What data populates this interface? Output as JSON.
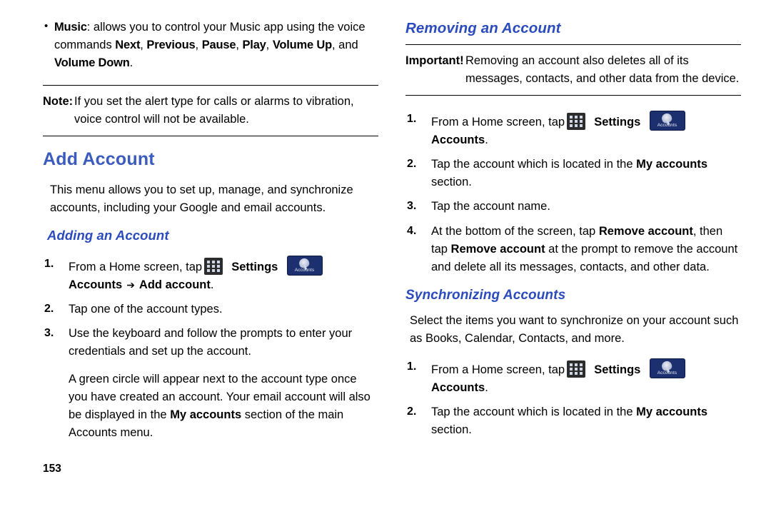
{
  "document": {
    "page_number": "153",
    "left_column": {
      "bullet": {
        "term": "Music",
        "text_1": ": allows you to control your Music app using the voice commands ",
        "cmd_1": "Next",
        "sep_1": ", ",
        "cmd_2": "Previous",
        "sep_2": ", ",
        "cmd_3": "Pause",
        "sep_3": ", ",
        "cmd_4": "Play",
        "sep_4": ", ",
        "cmd_5": "Volume Up",
        "sep_5": ", and ",
        "cmd_6": "Volume Down",
        "end": "."
      },
      "note": {
        "label": "Note:",
        "text": "If you set the alert type for calls or alarms to vibration, voice control will not be available."
      },
      "heading": "Add Account",
      "intro": "This menu allows you to set up, manage, and synchronize accounts, including your Google and email accounts.",
      "subheading": "Adding an Account",
      "steps": [
        {
          "num": "1.",
          "pre": "From a Home screen, tap",
          "icon_apps": "apps-icon",
          "bold_1": "Settings",
          "icon_accounts": "accounts-icon",
          "bold_2": "Accounts",
          "arrow": "➔",
          "bold_3": "Add account",
          "post": "."
        },
        {
          "num": "2.",
          "text": "Tap one of the account types."
        },
        {
          "num": "3.",
          "text": "Use the keyboard and follow the prompts to enter your credentials and set up the account."
        }
      ],
      "paragraph_pre": "A green circle will appear next to the account type once you have created an account. Your email account will also be displayed in the ",
      "paragraph_bold": "My accounts",
      "paragraph_post": " section of the main Accounts menu."
    },
    "right_column": {
      "heading": "Removing an Account",
      "important": {
        "label": "Important!",
        "text": "Removing an account also deletes all of its messages, contacts, and other data from the device."
      },
      "remove_steps": [
        {
          "num": "1.",
          "pre": "From a Home screen, tap",
          "icon_apps": "apps-icon",
          "bold_1": "Settings",
          "icon_accounts": "accounts-icon",
          "bold_2": "Accounts",
          "post": "."
        },
        {
          "num": "2.",
          "pre": "Tap the account which is located in the ",
          "bold": "My accounts",
          "post": " section."
        },
        {
          "num": "3.",
          "text": "Tap the account name."
        },
        {
          "num": "4.",
          "pre": "At the bottom of the screen, tap ",
          "bold_1": "Remove account",
          "mid_1": ", then tap ",
          "bold_2": "Remove account",
          "post": " at the prompt to remove the account and delete all its messages, contacts, and other data."
        }
      ],
      "sync_heading": "Synchronizing Accounts",
      "sync_intro": "Select the items you want to synchronize on your account such as Books, Calendar, Contacts, and more.",
      "sync_steps": [
        {
          "num": "1.",
          "pre": "From a Home screen, tap",
          "icon_apps": "apps-icon",
          "bold_1": "Settings",
          "icon_accounts": "accounts-icon",
          "bold_2": "Accounts",
          "post": "."
        },
        {
          "num": "2.",
          "pre": "Tap the account which is located in the ",
          "bold": "My accounts",
          "post": " section."
        }
      ]
    }
  },
  "icons": {
    "apps_label": "apps-grid-icon",
    "accounts_label": "Accounts"
  }
}
